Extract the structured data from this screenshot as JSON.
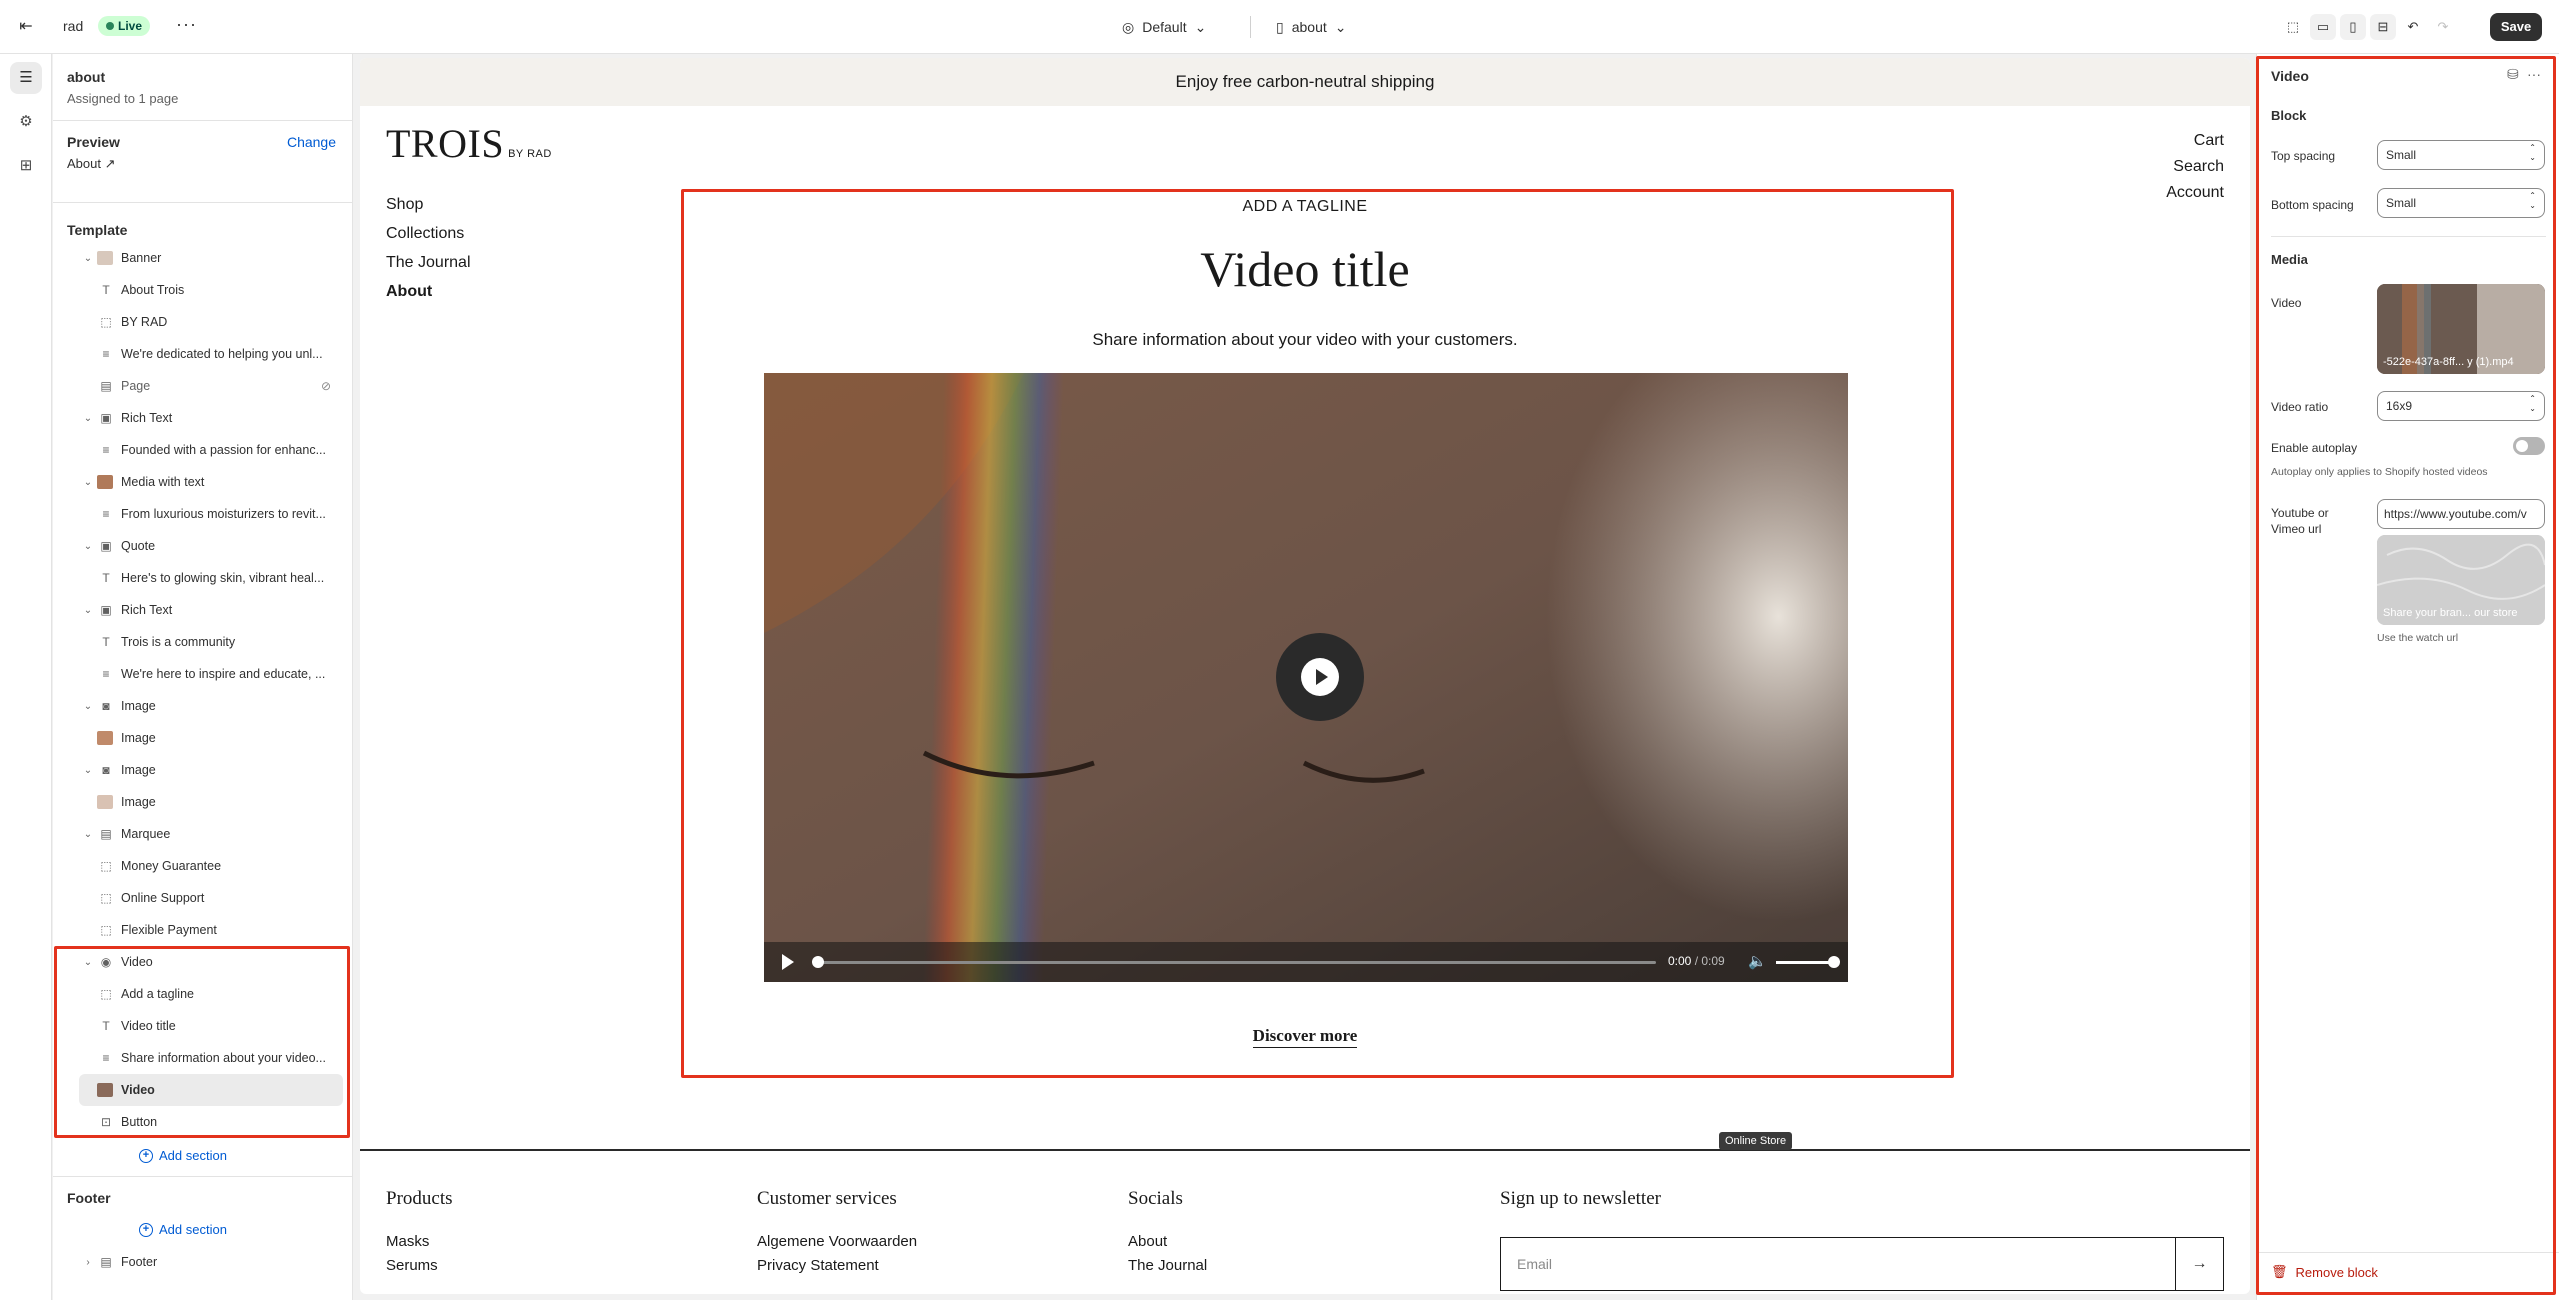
{
  "topbar": {
    "store_name": "rad",
    "live_badge": "Live",
    "more_label": "···",
    "theme_label": "Default",
    "page_label": "about",
    "save_label": "Save"
  },
  "sidebar": {
    "title": "about",
    "subtitle": "Assigned to 1 page",
    "preview_label": "Preview",
    "change_label": "Change",
    "preview_value": "About",
    "template_label": "Template",
    "rows": [
      {
        "label": "Banner"
      },
      {
        "label": "About Trois"
      },
      {
        "label": "BY RAD"
      },
      {
        "label": "We're dedicated to helping you unl..."
      },
      {
        "label": "Page"
      },
      {
        "label": "Rich Text"
      },
      {
        "label": "Founded with a passion for enhanc..."
      },
      {
        "label": "Media with text"
      },
      {
        "label": "From luxurious moisturizers to revit..."
      },
      {
        "label": "Quote"
      },
      {
        "label": "Here's to glowing skin, vibrant heal..."
      },
      {
        "label": "Rich Text"
      },
      {
        "label": "Trois is a community"
      },
      {
        "label": "We're here to inspire and educate, ..."
      },
      {
        "label": "Image"
      },
      {
        "label": "Image"
      },
      {
        "label": "Image"
      },
      {
        "label": "Image"
      },
      {
        "label": "Marquee"
      },
      {
        "label": "Money Guarantee"
      },
      {
        "label": "Online Support"
      },
      {
        "label": "Flexible Payment"
      },
      {
        "label": "Video"
      },
      {
        "label": "Add a tagline"
      },
      {
        "label": "Video title"
      },
      {
        "label": "Share information about your video..."
      },
      {
        "label": "Video"
      },
      {
        "label": "Button"
      }
    ],
    "add_section_label": "Add section",
    "footer_label": "Footer",
    "footer_add_section": "Add section",
    "footer_item": "Footer"
  },
  "preview": {
    "announcement": "Enjoy free carbon-neutral shipping",
    "logo": "TROIS",
    "logo_sub": "BY RAD",
    "nav_left": [
      "Shop",
      "Collections",
      "The Journal",
      "About"
    ],
    "nav_right": [
      "Cart",
      "Search",
      "Account"
    ],
    "tagline": "ADD A TAGLINE",
    "video_title": "Video title",
    "video_desc": "Share information about your video with your customers.",
    "time_current": "0:00",
    "time_total": "/ 0:09",
    "discover": "Discover more",
    "store_tag": "Online Store",
    "footer": {
      "col1_title": "Products",
      "col1_items": [
        "Masks",
        "Serums"
      ],
      "col2_title": "Customer services",
      "col2_items": [
        "Algemene Voorwaarden",
        "Privacy Statement"
      ],
      "col3_title": "Socials",
      "col3_items": [
        "About",
        "The Journal"
      ],
      "col4_title": "Sign up to newsletter",
      "email_placeholder": "Email"
    }
  },
  "panel": {
    "title": "Video",
    "block_heading": "Block",
    "top_spacing_label": "Top spacing",
    "top_spacing_value": "Small",
    "bottom_spacing_label": "Bottom spacing",
    "bottom_spacing_value": "Small",
    "media_heading": "Media",
    "video_label": "Video",
    "video_file": "-522e-437a-8ff... y (1).mp4",
    "ratio_label": "Video ratio",
    "ratio_value": "16x9",
    "autoplay_label": "Enable autoplay",
    "autoplay_help": "Autoplay only applies to Shopify hosted videos",
    "url_label_1": "Youtube or",
    "url_label_2": "Vimeo url",
    "url_value": "https://www.youtube.com/v",
    "url_thumb_caption": "Share your bran... our store",
    "url_help": "Use the watch url",
    "remove_label": "Remove block"
  },
  "colors": {
    "accent": "#005bd3",
    "highlight": "#e3321d",
    "danger": "#b81c0d"
  }
}
